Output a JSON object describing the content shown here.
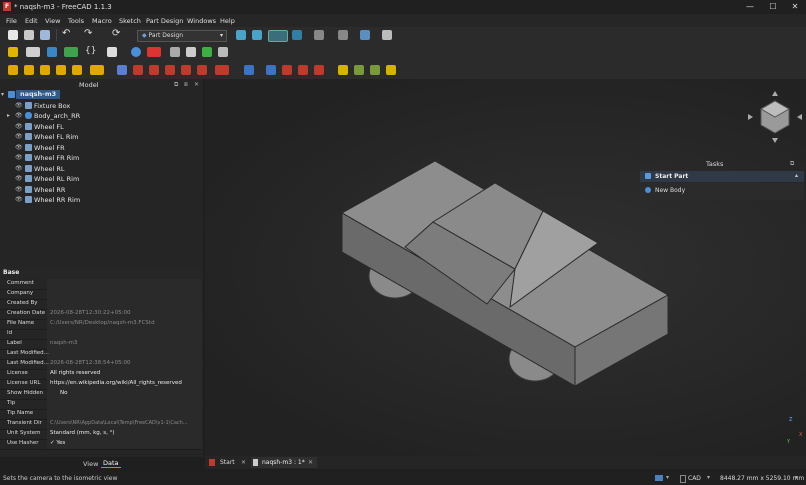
{
  "window": {
    "title": "* naqsh-m3 - FreeCAD 1.1.3",
    "logo": "F",
    "controls": [
      "—",
      "☐",
      "✕"
    ]
  },
  "menu": [
    "File",
    "Edit",
    "View",
    "Tools",
    "Macro",
    "Sketch",
    "Part Design",
    "Windows",
    "Help"
  ],
  "workbench": {
    "selected": "Part Design"
  },
  "model_panel": {
    "header": "Model",
    "root": "naqsh-m3",
    "items": [
      {
        "label": "Fixture Box",
        "expandable": false
      },
      {
        "label": "Body_arch_RR",
        "expandable": true
      },
      {
        "label": "Wheel FL",
        "expandable": false
      },
      {
        "label": "Wheel FL Rim",
        "expandable": false
      },
      {
        "label": "Wheel FR",
        "expandable": false
      },
      {
        "label": "Wheel FR Rim",
        "expandable": false
      },
      {
        "label": "Wheel RL",
        "expandable": false
      },
      {
        "label": "Wheel RL Rim",
        "expandable": false
      },
      {
        "label": "Wheel RR",
        "expandable": false
      },
      {
        "label": "Wheel RR Rim",
        "expandable": false
      }
    ]
  },
  "properties": {
    "group": "Base",
    "rows": [
      {
        "name": "Comment",
        "value": "",
        "dim": false
      },
      {
        "name": "Company",
        "value": "",
        "dim": false
      },
      {
        "name": "Created By",
        "value": "",
        "dim": false
      },
      {
        "name": "Creation Date",
        "value": "2026-08-28T12:30:22+05:00",
        "dim": true
      },
      {
        "name": "File Name",
        "value": "C:/Users/NR/Desktop/naqsh-m3.FCStd",
        "dim": true
      },
      {
        "name": "Id",
        "value": "",
        "dim": false
      },
      {
        "name": "Label",
        "value": "naqsh-m3",
        "dim": true
      },
      {
        "name": "Last Modified...",
        "value": "",
        "dim": false
      },
      {
        "name": "Last Modified...",
        "value": "2026-08-28T12:38:54+05:00",
        "dim": true
      },
      {
        "name": "License",
        "value": "All rights reserved",
        "dim": false
      },
      {
        "name": "License URL",
        "value": "https://en.wikipedia.org/wiki/All_rights_reserved",
        "dim": false
      },
      {
        "name": "Show Hidden",
        "value": "No",
        "dim": false
      },
      {
        "name": "Tip",
        "value": "",
        "dim": false
      },
      {
        "name": "Tip Name",
        "value": "",
        "dim": false
      },
      {
        "name": "Transient Dir",
        "value": "C:\\Users\\NR\\AppData\\Local\\Temp\\FreeCAD\\v1-1\\Cach...",
        "dim": true
      },
      {
        "name": "Unit System",
        "value": "Standard (mm, kg, s, °)",
        "dim": false
      },
      {
        "name": "Use Hasher",
        "value": "✓ Yes",
        "dim": false
      }
    ],
    "tabs": [
      "View",
      "Data"
    ],
    "active_tab": "Data"
  },
  "tasks": {
    "header": "Tasks",
    "section": "Start Part",
    "action": "New Body"
  },
  "doc_tabs": [
    {
      "label": "Start",
      "close": "✕"
    },
    {
      "label": "naqsh-m3 : 1*",
      "close": "✕"
    }
  ],
  "status": {
    "message": "Sets the camera to the isometric view",
    "nav_style": "CAD",
    "dimensions": "8448.27 mm x 5259.10 mm"
  },
  "nav_cube": {
    "axis_z": "Z",
    "axis_x": "X",
    "axis_y": "Y"
  }
}
